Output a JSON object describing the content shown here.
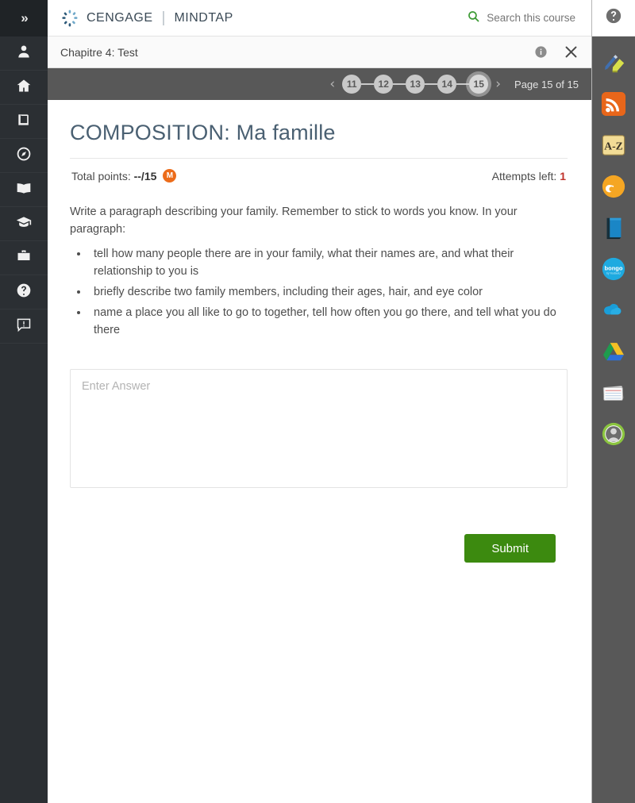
{
  "header": {
    "brand": "CENGAGE",
    "brand_divider": "|",
    "product": "MINDTAP",
    "search_label": "Search this course",
    "search_icon": "search-icon",
    "help_icon": "help-circle-icon",
    "search_icon_color": "#3d9b35"
  },
  "chapter_bar": {
    "title": "Chapitre 4: Test",
    "info_icon": "info-circle-icon",
    "close_icon": "close-x-icon"
  },
  "pager": {
    "prev_arrow": "‹",
    "next_arrow": "›",
    "pages": [
      "11",
      "12",
      "13",
      "14",
      "15"
    ],
    "active_page": "15",
    "label": "Page 15 of 15"
  },
  "assignment": {
    "title": "COMPOSITION: Ma famille",
    "points_label": "Total points: ",
    "points_value": "--/15",
    "points_badge": "M",
    "points_badge_color": "#ec6c1a",
    "attempts_label": "Attempts left: ",
    "attempts_value": "1",
    "attempts_value_color": "#c0322b",
    "prompt": "Write a paragraph describing your family. Remember to stick to words you know. In your paragraph:",
    "bullets": [
      "tell how many people there are in your family, what their names are, and what their relationship to you is",
      "briefly describe two family members, including their ages, hair, and eye color",
      "name a place you all like to go to together, tell how often you go there, and tell what you do there"
    ],
    "answer_placeholder": "Enter Answer",
    "answer_value": "",
    "submit_label": "Submit",
    "submit_color": "#3c8a0f"
  },
  "left_rail": {
    "toggle_icon": "chevron-double-right-icon",
    "toggle_label": "»",
    "items": [
      {
        "icon": "person-icon",
        "name": "profile"
      },
      {
        "icon": "home-icon",
        "name": "home"
      },
      {
        "icon": "book-closed-icon",
        "name": "course"
      },
      {
        "icon": "compass-icon",
        "name": "explore"
      },
      {
        "icon": "open-book-icon",
        "name": "reader"
      },
      {
        "icon": "graduation-cap-icon",
        "name": "grades"
      },
      {
        "icon": "briefcase-icon",
        "name": "career"
      },
      {
        "icon": "question-circle-icon",
        "name": "help"
      },
      {
        "icon": "feedback-comment-icon",
        "name": "feedback"
      }
    ]
  },
  "right_rail": {
    "items": [
      {
        "icon": "highlighter-pen-icon",
        "name": "notes-highlights"
      },
      {
        "icon": "rss-feed-icon",
        "name": "rss-reader",
        "color": "#e8661a"
      },
      {
        "icon": "a-z-dictionary-icon",
        "name": "dictionary",
        "label": "A-Z",
        "color": "#f1d98a"
      },
      {
        "icon": "flipboard-logo-icon",
        "name": "readspeaker",
        "color": "#f5a623"
      },
      {
        "icon": "blue-book-icon",
        "name": "ebook",
        "color": "#1a7fc1"
      },
      {
        "icon": "bongo-logo-icon",
        "name": "bongo",
        "label": "bongo",
        "color": "#1eaae0"
      },
      {
        "icon": "onedrive-cloud-icon",
        "name": "onedrive",
        "color": "#1a9ed9"
      },
      {
        "icon": "google-drive-icon",
        "name": "google-drive"
      },
      {
        "icon": "flashcards-icon",
        "name": "flashcards"
      },
      {
        "icon": "user-avatar-icon",
        "name": "account-avatar",
        "color": "#8bc53f"
      }
    ]
  }
}
